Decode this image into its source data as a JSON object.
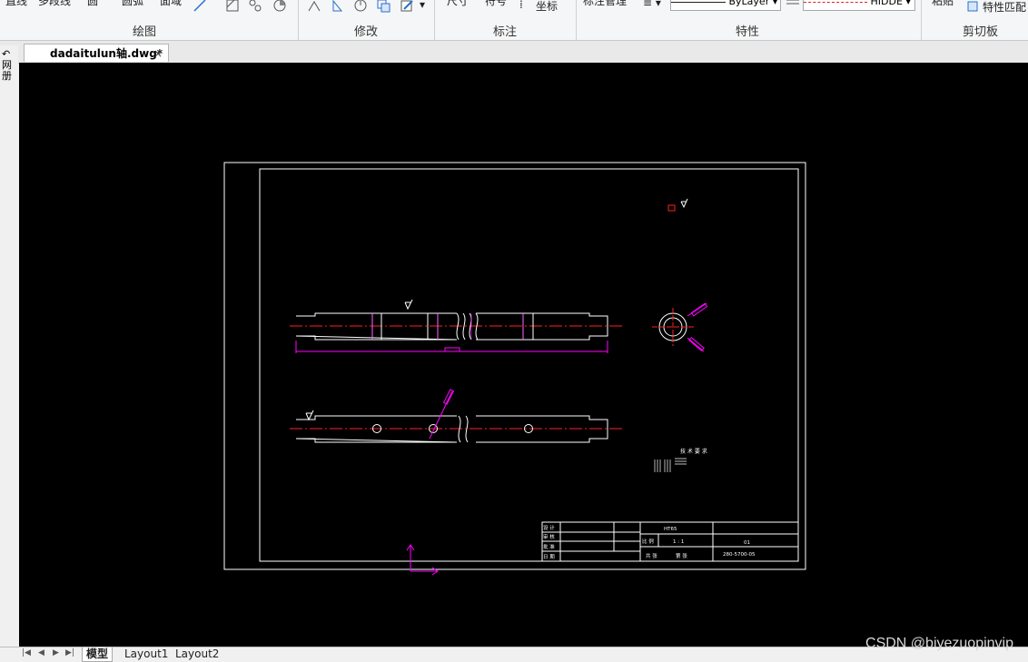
{
  "ribbon": {
    "panels": [
      {
        "label": "绘图"
      },
      {
        "label": "修改"
      },
      {
        "label": "标注"
      },
      {
        "label": "特性"
      },
      {
        "label": "剪切板"
      }
    ],
    "cut_labels": {
      "a": "直线",
      "b": "多段线",
      "c": "圆",
      "d": "圆弧",
      "e": "面域",
      "f": "尺寸",
      "g": "符号",
      "h": "坐标",
      "i": "标注管理",
      "j": "粘贴",
      "k": "特性匹配"
    },
    "linetype_value": "ByLayer",
    "lineweight_value": "HIDDE"
  },
  "document_tab": {
    "title": "dadaitulun轴.dwg*",
    "close": "×"
  },
  "side_tools": [
    "↶",
    "网",
    "册"
  ],
  "drawing": {
    "title_block": {
      "material": "HT65",
      "scale": "1 : 1",
      "sheet": "01",
      "drawing_no": "280-5700-05",
      "rows_left": [
        "设 计",
        "审 核",
        "批 准",
        "日 期"
      ],
      "col_labels": [
        "比 例",
        "共 张",
        "第 张"
      ]
    },
    "notes_title": "技 术 要 求"
  },
  "layout_tabs": [
    {
      "label": "模型",
      "active": true
    },
    {
      "label": "Layout1",
      "active": false
    },
    {
      "label": "Layout2",
      "active": false
    }
  ],
  "nav_buttons": [
    "|◀",
    "◀",
    "▶",
    "▶|"
  ],
  "watermark": "CSDN @biyezuopinvip",
  "colors": {
    "canvas_bg": "#000000",
    "outline": "#ffffff",
    "centerline": "#ff2020",
    "dimension": "#ff00ff"
  }
}
